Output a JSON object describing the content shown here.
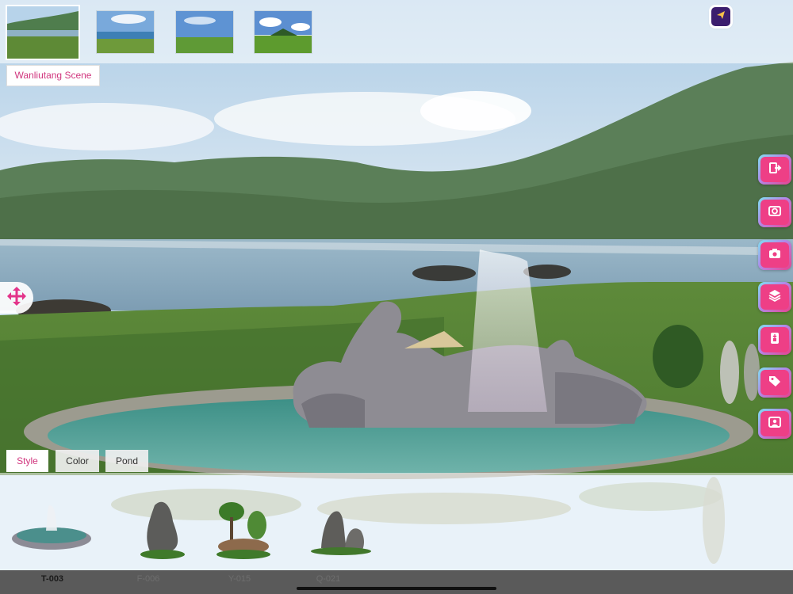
{
  "scene": {
    "label": "Wanliutang Scene"
  },
  "topbar": {
    "thumbnails": [
      "scene-thumb-1",
      "scene-thumb-2",
      "scene-thumb-3",
      "scene-thumb-4"
    ],
    "send_icon": "paper-plane-icon"
  },
  "tools": [
    {
      "name": "exit-icon"
    },
    {
      "name": "photo-zoom-icon"
    },
    {
      "name": "camera-icon"
    },
    {
      "name": "layers-icon"
    },
    {
      "name": "save-icon"
    },
    {
      "name": "tag-icon"
    },
    {
      "name": "profile-icon"
    }
  ],
  "tabs": [
    {
      "label": "Style",
      "active": true
    },
    {
      "label": "Color",
      "active": false
    },
    {
      "label": "Pond",
      "active": false
    }
  ],
  "codes": [
    {
      "label": "T-003",
      "active": true
    },
    {
      "label": "F-006",
      "active": false
    },
    {
      "label": "Y-015",
      "active": false
    },
    {
      "label": "Q-021",
      "active": false
    }
  ],
  "colors": {
    "accent": "#ee3f86",
    "send_bg": "#3b1d6e",
    "label_text": "#d1367e"
  }
}
